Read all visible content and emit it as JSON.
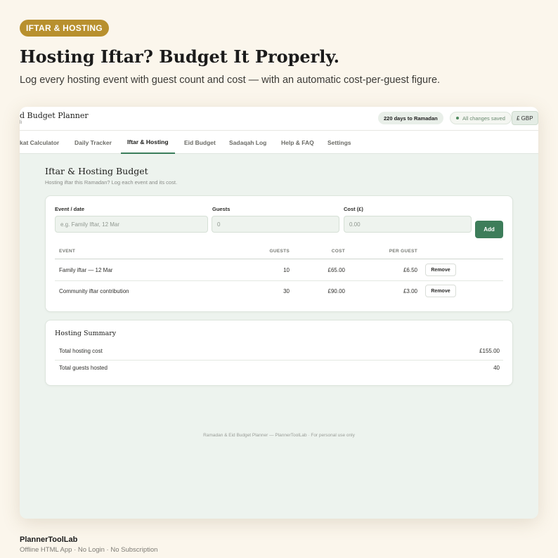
{
  "badge": "IFTAR & HOSTING",
  "headline": "Hosting Iftar? Budget It Properly.",
  "subheadline": "Log every hosting event with guest count and cost — with an automatic cost-per-guest figure.",
  "app": {
    "title": "d Budget Planner",
    "subtitle": "li",
    "days_to_ramadan": "220 days to Ramadan",
    "saved_status": "All changes saved",
    "currency": "£ GBP",
    "tabs": [
      "kat Calculator",
      "Daily Tracker",
      "Iftar & Hosting",
      "Eid Budget",
      "Sadaqah Log",
      "Help & FAQ",
      "Settings"
    ],
    "active_tab": "Iftar & Hosting",
    "section_title": "Iftar & Hosting Budget",
    "section_subtitle": "Hosting iftar this Ramadan? Log each event and its cost.",
    "form": {
      "event_label": "Event / date",
      "event_placeholder": "e.g. Family Iftar, 12 Mar",
      "guests_label": "Guests",
      "guests_placeholder": "0",
      "cost_label": "Cost (£)",
      "cost_placeholder": "0.00",
      "add_label": "Add"
    },
    "table": {
      "headers": [
        "EVENT",
        "GUESTS",
        "COST",
        "PER GUEST"
      ],
      "rows": [
        {
          "event": "Family iftar — 12 Mar",
          "guests": "10",
          "cost": "£65.00",
          "per_guest": "£6.50"
        },
        {
          "event": "Community iftar contribution",
          "guests": "30",
          "cost": "£90.00",
          "per_guest": "£3.00"
        }
      ],
      "remove_label": "Remove"
    },
    "summary": {
      "title": "Hosting Summary",
      "total_cost_label": "Total hosting cost",
      "total_cost_value": "£155.00",
      "total_guests_label": "Total guests hosted",
      "total_guests_value": "40"
    },
    "footer": "Ramadan & Eid Budget Planner — PlannerToolLab · For personal use only"
  },
  "brand": {
    "name": "PlannerToolLab",
    "tagline": "Offline HTML App  ·  No Login  ·  No Subscription"
  },
  "colors": {
    "badge": "#b8902e",
    "accent_green": "#3d7d5a",
    "page_bg": "#fbf6ec",
    "app_bg": "#edf3ee"
  }
}
